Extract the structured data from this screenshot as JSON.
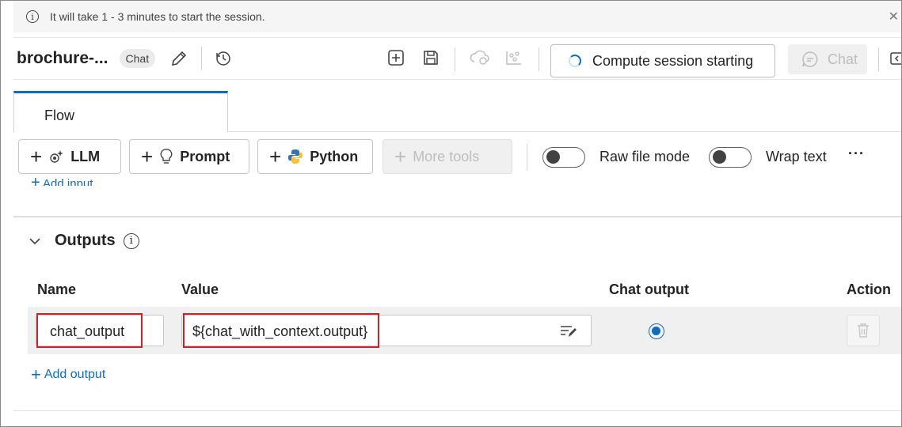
{
  "banner": {
    "message": "It will take 1 - 3 minutes to start the session."
  },
  "header": {
    "title": "brochure-...",
    "badge": "Chat",
    "compute_status": "Compute session starting",
    "chat_button": "Chat"
  },
  "tabs": {
    "flow": "Flow"
  },
  "toolbar": {
    "llm": "LLM",
    "prompt": "Prompt",
    "python": "Python",
    "more_tools": "More tools",
    "raw_file_mode": "Raw file mode",
    "wrap_text": "Wrap text",
    "more": "···"
  },
  "inputs": {
    "add_input": "Add input"
  },
  "outputs": {
    "title": "Outputs",
    "columns": {
      "name": "Name",
      "value": "Value",
      "chat_output": "Chat output",
      "action": "Action"
    },
    "rows": [
      {
        "name": "chat_output",
        "value": "${chat_with_context.output}",
        "chat_output_selected": true
      }
    ],
    "add_output": "Add output"
  },
  "colors": {
    "accent": "#0f6cbd",
    "highlight": "#d0202a"
  }
}
